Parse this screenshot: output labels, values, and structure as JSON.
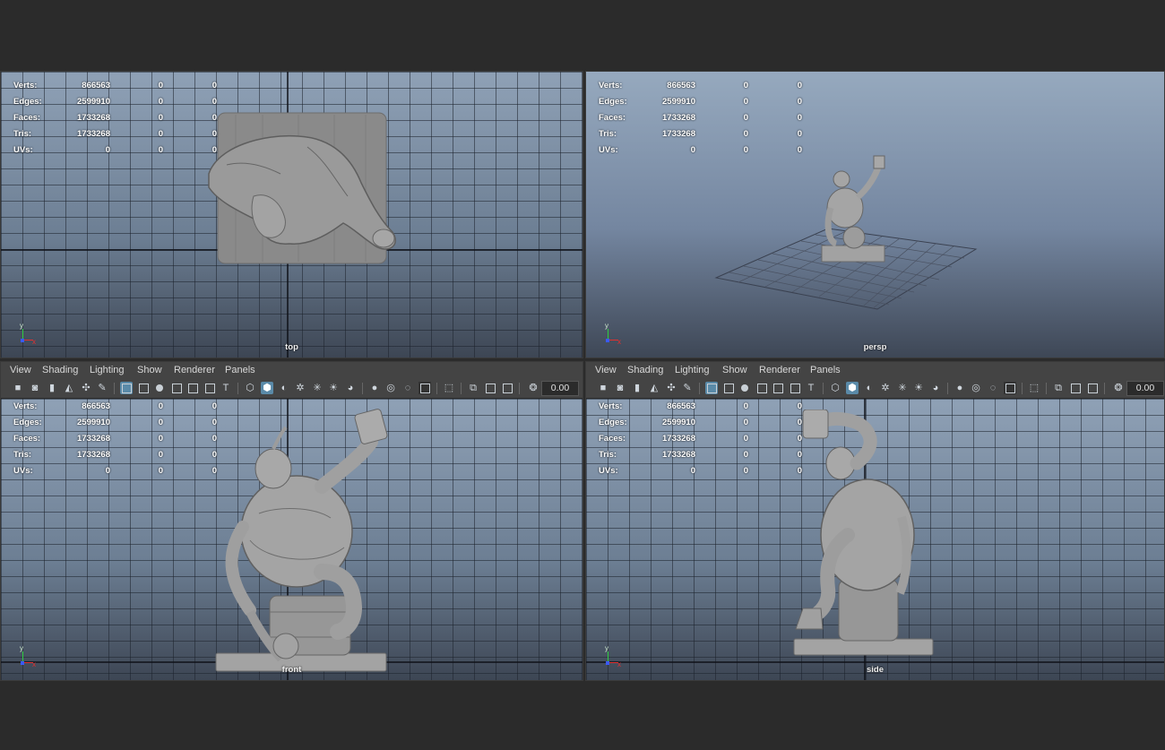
{
  "menu": [
    "View",
    "Shading",
    "Lighting",
    "Show",
    "Renderer",
    "Panels"
  ],
  "field_value": "0.00",
  "hud_rows": [
    {
      "label": "Verts:",
      "v1": "866563",
      "v2": "0",
      "v3": "0"
    },
    {
      "label": "Edges:",
      "v1": "2599910",
      "v2": "0",
      "v3": "0"
    },
    {
      "label": "Faces:",
      "v1": "1733268",
      "v2": "0",
      "v3": "0"
    },
    {
      "label": "Tris:",
      "v1": "1733268",
      "v2": "0",
      "v3": "0"
    },
    {
      "label": "UVs:",
      "v1": "0",
      "v2": "0",
      "v3": "0"
    }
  ],
  "viewports": {
    "top": {
      "camera": "top"
    },
    "persp": {
      "camera": "persp"
    },
    "front": {
      "camera": "front"
    },
    "side": {
      "camera": "side"
    }
  },
  "axis_labels": {
    "x": "x",
    "y": "y"
  },
  "toolbar_icons": [
    "camera-icon",
    "camera-attributes-icon",
    "bookmark-icon",
    "image-plane-icon",
    "2d-pan-zoom-icon",
    "grease-pencil-icon",
    "grid-icon",
    "film-gate-icon",
    "resolution-gate-icon",
    "gate-mask-icon",
    "field-chart-icon",
    "safe-action-icon",
    "safe-title-icon",
    "wireframe-icon",
    "smooth-shade-icon",
    "wireframe-on-shaded-icon",
    "textured-icon",
    "use-all-lights-icon",
    "shadows-icon",
    "screen-space-ao-icon",
    "motion-blur-icon",
    "multisample-aa-icon",
    "depth-of-field-icon",
    "isolate-select-icon",
    "xray-icon",
    "xray-joints-icon",
    "xray-active-icon",
    "backface-culling-icon",
    "exposure-icon",
    "gamma-icon"
  ],
  "colors": {
    "background": "#2b2b2b",
    "panel": "#444444",
    "viewport_top": "#8fa1b6",
    "viewport_bottom": "#3d4654",
    "selected_tool": "#5a8aa8"
  }
}
